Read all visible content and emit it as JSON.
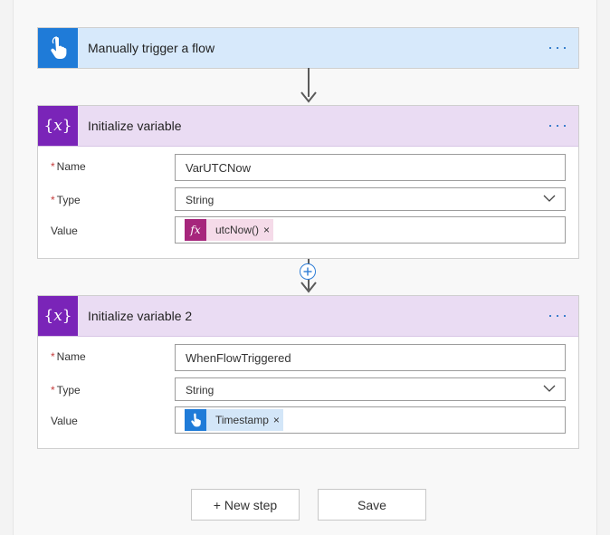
{
  "steps": [
    {
      "title": "Manually trigger a flow",
      "icon": "hand-touch-icon",
      "menu": "···"
    },
    {
      "title": "Initialize variable",
      "icon": "variable-braces-icon",
      "menu": "···",
      "fields": {
        "name_label": "Name",
        "name_value": "VarUTCNow",
        "type_label": "Type",
        "type_value": "String",
        "value_label": "Value",
        "value_token": "utcNow()",
        "value_token_icon": "fx",
        "value_token_remove": "×"
      }
    },
    {
      "title": "Initialize variable 2",
      "icon": "variable-braces-icon",
      "menu": "···",
      "fields": {
        "name_label": "Name",
        "name_value": "WhenFlowTriggered",
        "type_label": "Type",
        "type_value": "String",
        "value_label": "Value",
        "value_token": "Timestamp",
        "value_token_icon": "hand-touch-icon",
        "value_token_remove": "×"
      }
    }
  ],
  "required_mark": "*",
  "buttons": {
    "new_step": "+ New step",
    "save": "Save"
  },
  "colors": {
    "trigger_accent": "#1f7bd8",
    "trigger_header": "#d7e9fb",
    "variable_accent": "#7a24b8",
    "variable_header": "#eadcf3",
    "expression_token": "#a6267c",
    "link_blue": "#1f6fc5"
  }
}
